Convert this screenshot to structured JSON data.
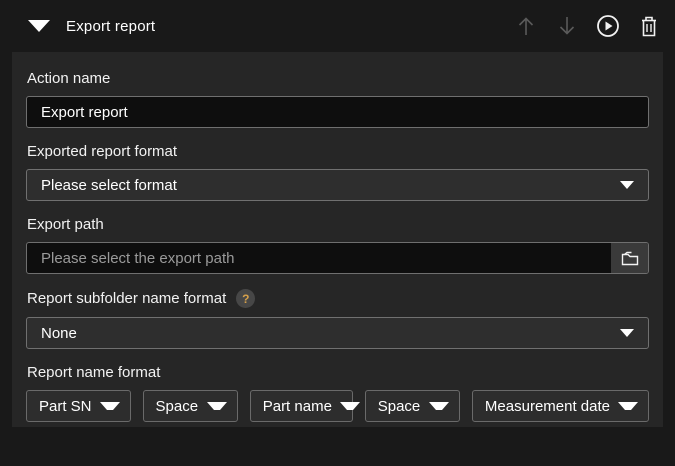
{
  "header": {
    "title": "Export report",
    "collapse_icon": "triangle-down",
    "actions": {
      "move_up": "arrow-up",
      "move_down": "arrow-down",
      "run": "play-circle",
      "delete": "trash"
    }
  },
  "form": {
    "action_name": {
      "label": "Action name",
      "value": "Export report"
    },
    "report_format": {
      "label": "Exported report format",
      "selected": "Please select format"
    },
    "export_path": {
      "label": "Export path",
      "placeholder": "Please select the export path",
      "browse_icon": "folder"
    },
    "subfolder_format": {
      "label": "Report subfolder name format",
      "help": "?",
      "selected": "None"
    },
    "report_name_format": {
      "label": "Report name format",
      "segments": [
        {
          "value": "Part SN"
        },
        {
          "value": "Space"
        },
        {
          "value": "Part name"
        },
        {
          "value": "Space"
        },
        {
          "value": "Measurement date"
        }
      ]
    }
  },
  "colors": {
    "page_bg": "#191919",
    "panel_bg": "#262626",
    "input_bg": "#0e0e0e",
    "select_bg": "#2e2e2e",
    "border": "#6f6f6f",
    "text": "#ffffff",
    "placeholder": "#9a9a9a",
    "help_accent": "#d5a04b",
    "disabled_icon": "#5a5a5a"
  }
}
